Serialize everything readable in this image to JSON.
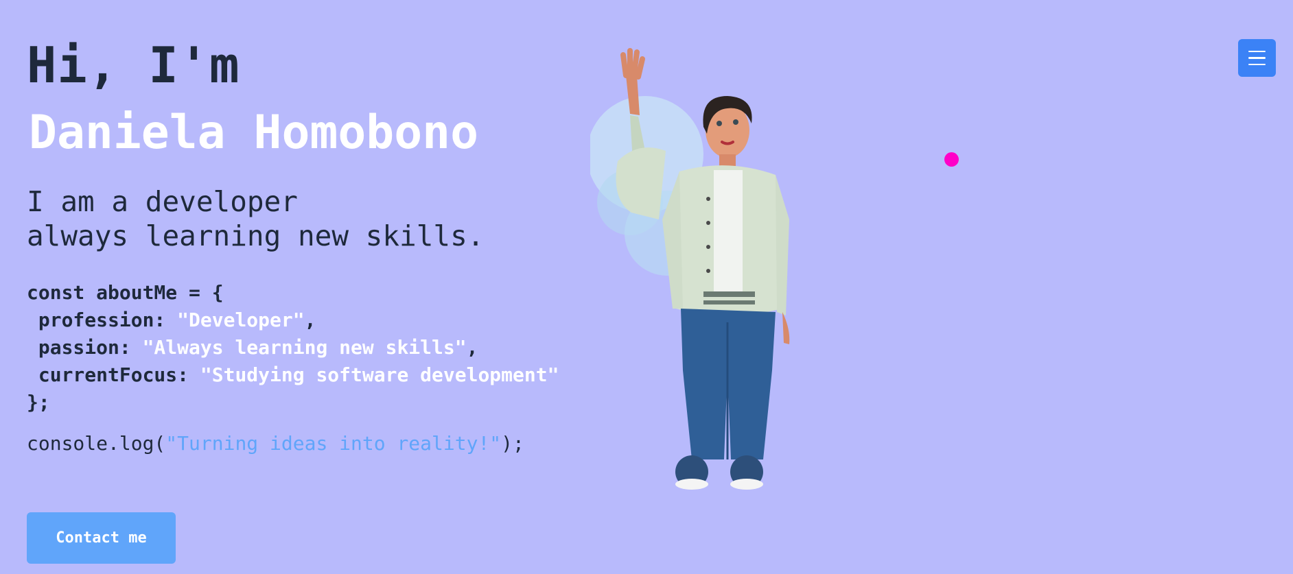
{
  "colors": {
    "background": "#b8bafc",
    "text_dark": "#1e293b",
    "name_color": "#ffffff",
    "accent_blue": "#60a5fa",
    "menu_blue": "#3b82f6",
    "dot_magenta": "#ff00c8"
  },
  "hero": {
    "greeting": "Hi, I'm",
    "name": "Daniela Homobono",
    "tagline_line1": "I am a developer",
    "tagline_line2": "always learning new skills."
  },
  "code": {
    "line1": "const aboutMe = {",
    "profession_key": " profession: ",
    "profession_value": "\"Developer\"",
    "profession_end": ",",
    "passion_key": " passion: ",
    "passion_value": "\"Always learning new skills\"",
    "passion_end": ",",
    "focus_key": " currentFocus: ",
    "focus_value": "\"Studying software development\"",
    "closing": "};",
    "console_prefix": "console.log(",
    "console_string": "\"Turning ideas into reality!\"",
    "console_suffix": ");"
  },
  "actions": {
    "contact_label": "Contact me"
  },
  "icons": {
    "menu": "hamburger-menu-icon",
    "avatar": "waving-3d-avatar",
    "dot": "cursor-dot"
  }
}
